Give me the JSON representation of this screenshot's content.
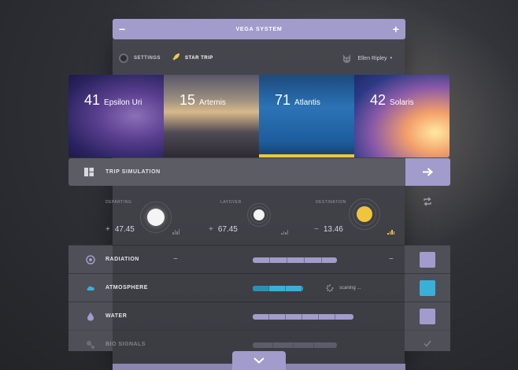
{
  "titlebar": {
    "title": "VEGA SYSTEM",
    "minus": "−",
    "plus": "+"
  },
  "nav": {
    "items": [
      {
        "label": "SETTINGS",
        "icon": "gear-icon"
      },
      {
        "label": "STAR TRIP",
        "icon": "rocket-icon"
      }
    ],
    "user": {
      "name": "Ellen Ripley",
      "caret": "▾",
      "icon": "cat-avatar-icon"
    }
  },
  "destinations": [
    {
      "number": "41",
      "name": "Epsilon Uri"
    },
    {
      "number": "15",
      "name": "Artemis"
    },
    {
      "number": "71",
      "name": "Atlantis",
      "selected": true
    },
    {
      "number": "42",
      "name": "Solaris"
    }
  ],
  "trip": {
    "title": "TRIP SIMULATION",
    "go_icon": "arrow-right-icon"
  },
  "simulation": {
    "departing": {
      "caption": "DEPARTING",
      "op": "+",
      "value": "47.45"
    },
    "layover": {
      "caption": "LAYOVER",
      "op": "+",
      "value": "67.45"
    },
    "destination": {
      "caption": "DESTINATION",
      "op": "−",
      "value": "13.46"
    },
    "repeat_icon": "repeat-icon"
  },
  "systems": [
    {
      "label": "RADIATION",
      "minus": "−",
      "status": "",
      "icon": "radiation-icon"
    },
    {
      "label": "ATMOSPHERE",
      "minus": "",
      "status": "scaning ...",
      "icon": "cloud-icon"
    },
    {
      "label": "WATER",
      "minus": "",
      "status": "",
      "icon": "drop-icon"
    },
    {
      "label": "BIO SIGNALS",
      "minus": "",
      "status": "",
      "icon": "bio-icon"
    }
  ],
  "colors": {
    "accent": "#a19ccb",
    "cyan": "#3aafd9",
    "yellow": "#f0c53e"
  }
}
